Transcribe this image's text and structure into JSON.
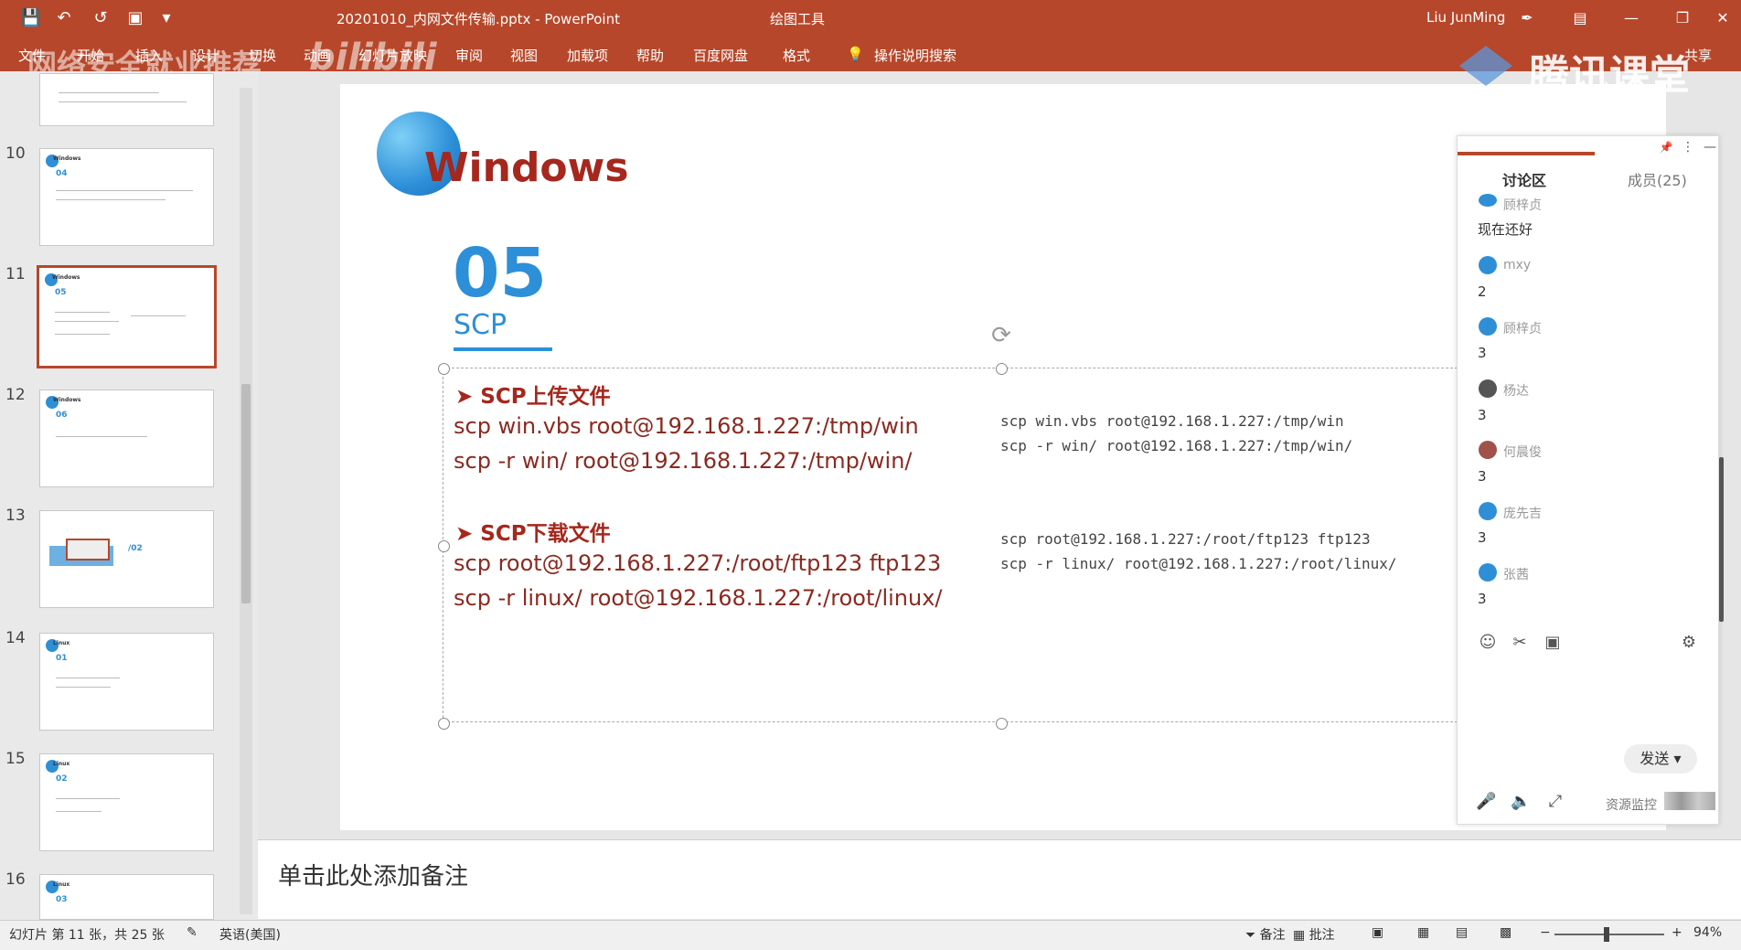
{
  "titlebar": {
    "doc_title": "20201010_内网文件传输.pptx  -  PowerPoint",
    "context_tool": "绘图工具",
    "user": "Liu JunMing"
  },
  "ribbon": {
    "tabs": [
      "文件",
      "开始",
      "插入",
      "设计",
      "切换",
      "动画",
      "幻灯片放映",
      "审阅",
      "视图",
      "加载项",
      "帮助",
      "百度网盘",
      "格式"
    ],
    "search": "操作说明搜索",
    "share": "共享",
    "watermark_left": "网络安全就业推荐",
    "watermark_bili": "bilibili",
    "watermark_right": "腾讯课堂"
  },
  "thumbnails": {
    "numbers": [
      "10",
      "11",
      "12",
      "13",
      "14",
      "15",
      "16"
    ],
    "items": [
      {
        "title": "Windows",
        "num": "04"
      },
      {
        "title": "Windows",
        "num": "05"
      },
      {
        "title": "Windows",
        "num": "06"
      },
      {
        "title": "",
        "num": "/02"
      },
      {
        "title": "Linux",
        "num": "01"
      },
      {
        "title": "Linux",
        "num": "02"
      },
      {
        "title": "Linux",
        "num": "03"
      }
    ]
  },
  "slide": {
    "title": "Windows",
    "number": "05",
    "subtitle": "SCP",
    "upload": {
      "heading": "SCP上传文件",
      "cmd1": "scp win.vbs root@192.168.1.227:/tmp/win",
      "cmd2": "scp -r win/ root@192.168.1.227:/tmp/win/",
      "mono1": "scp win.vbs root@192.168.1.227:/tmp/win",
      "mono2": "scp -r win/ root@192.168.1.227:/tmp/win/"
    },
    "download": {
      "heading": "SCP下载文件",
      "cmd1": "scp root@192.168.1.227:/root/ftp123 ftp123",
      "cmd2": "scp -r linux/ root@192.168.1.227:/root/linux/",
      "mono1": "scp root@192.168.1.227:/root/ftp123 ftp123",
      "mono2": "scp -r linux/ root@192.168.1.227:/root/linux/"
    }
  },
  "notes": {
    "placeholder": "单击此处添加备注"
  },
  "statusbar": {
    "slide_count": "幻灯片 第 11 张，共 25 张",
    "language": "英语(美国)",
    "notes": "备注",
    "comments": "批注",
    "zoom": "94%"
  },
  "chat": {
    "tab_discuss": "讨论区",
    "tab_members": "成员(25)",
    "messages": [
      {
        "name": "顾梓贞",
        "text": "现在还好"
      },
      {
        "name": "mxy",
        "text": "2"
      },
      {
        "name": "顾梓贞",
        "text": "3"
      },
      {
        "name": "杨达",
        "text": "3"
      },
      {
        "name": "何晨俊",
        "text": "3"
      },
      {
        "name": "庞先吉",
        "text": "3"
      },
      {
        "name": "张茜",
        "text": "3"
      }
    ],
    "send": "发送",
    "monitor": "资源监控"
  }
}
